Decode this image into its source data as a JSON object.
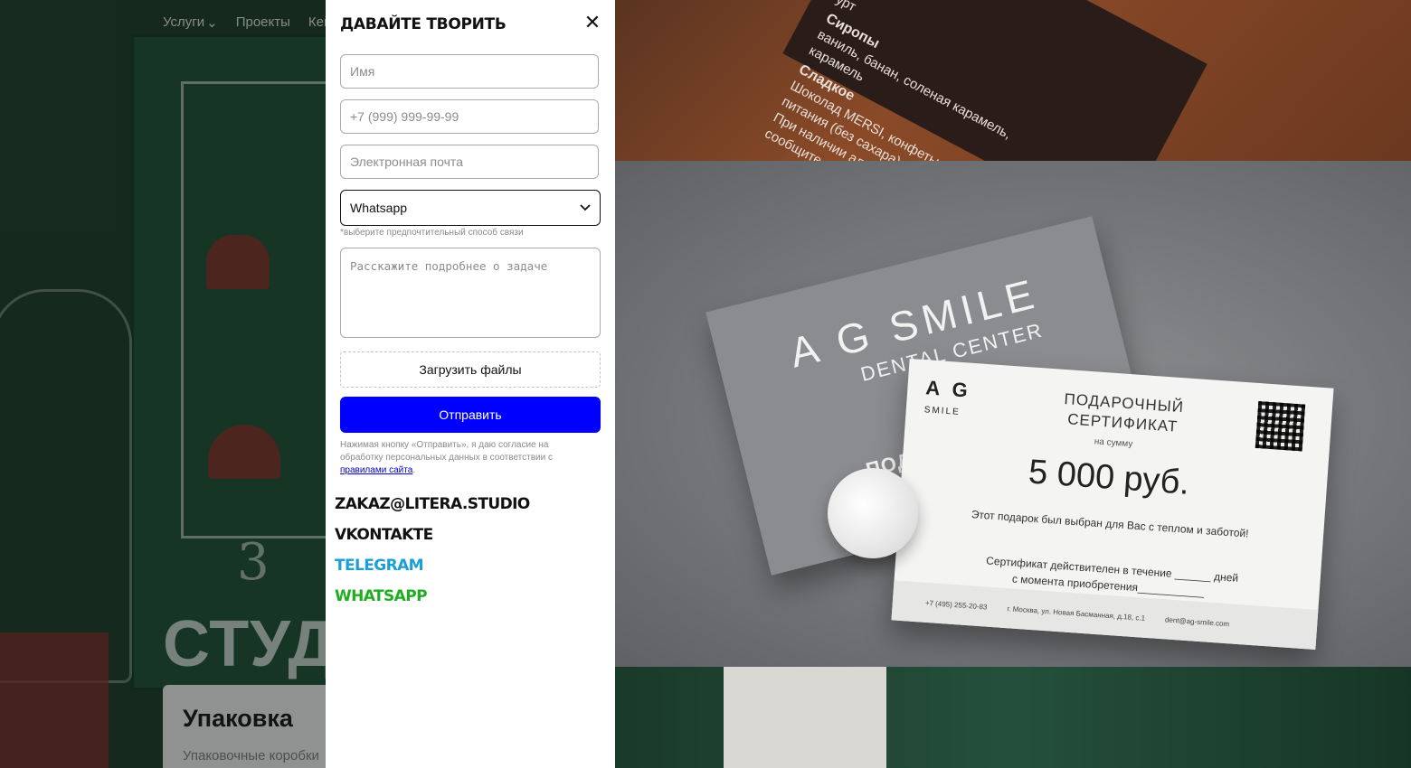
{
  "background": {
    "nav": [
      "Услуги",
      "Проекты",
      "Кей"
    ],
    "digit": "3",
    "studio_heading": "СТУД",
    "card": {
      "title": "Упаковка",
      "subtitle": "Упаковочные коробки"
    }
  },
  "photos": {
    "menu_card": {
      "line1": "урт",
      "line2": "Сиропы",
      "line3": "ваниль, банан, соленая карамель,",
      "line4": "карамель",
      "line5": "Сладкое",
      "line6": "Шоколад MERSI, конфеты правильного",
      "line7": "питания (без сахара)",
      "line8": "При наличии аллергии, пожалуйста",
      "line9": "сообщите нам об этом"
    },
    "envelope": {
      "logo": "A G SMILE",
      "sub": "DENTAL CENTER",
      "gift": "ПОДАРОЧНЫЙ"
    },
    "certificate": {
      "logo": "A G",
      "logo_sub": "SMILE",
      "title": "ПОДАРОЧНЫЙ СЕРТИФИКАТ",
      "sum_label": "на сумму",
      "sum": "5 000 руб.",
      "line1": "Этот подарок был выбран для Вас с теплом и заботой!",
      "line2": "Сертификат действителен в течение ______ дней",
      "line3": "с момента приобретения___________",
      "phone": "+7 (495) 255-20-83",
      "address": "г. Москва, ул. Новая Басманная, д.18, с.1",
      "email": "dent@ag-smile.com"
    }
  },
  "modal": {
    "title": "ДАВАЙТЕ ТВОРИТЬ",
    "close_glyph": "✕",
    "fields": {
      "name_placeholder": "Имя",
      "phone_placeholder": "+7 (999) 999-99-99",
      "email_placeholder": "Электронная почта",
      "contact_method_value": "Whatsapp",
      "contact_method_hint": "*выберите предпочтительный способ связи",
      "task_placeholder": "Расскажите подробнее о задаче"
    },
    "upload_label": "Загрузить файлы",
    "submit_label": "Отправить",
    "consent": {
      "text": "Нажимая кнопку «Отправить», я даю согласие на обработку персональных данных в соответствии с ",
      "link": "правилами сайта",
      "end": "."
    },
    "contacts": [
      {
        "label": "ZAKAZ@LITERA.STUDIO",
        "color": "#111111"
      },
      {
        "label": "VKONTAKTE",
        "color": "#111111"
      },
      {
        "label": "TELEGRAM",
        "color": "#1a9fd6"
      },
      {
        "label": "WHATSAPP",
        "color": "#1fae1f"
      }
    ]
  }
}
